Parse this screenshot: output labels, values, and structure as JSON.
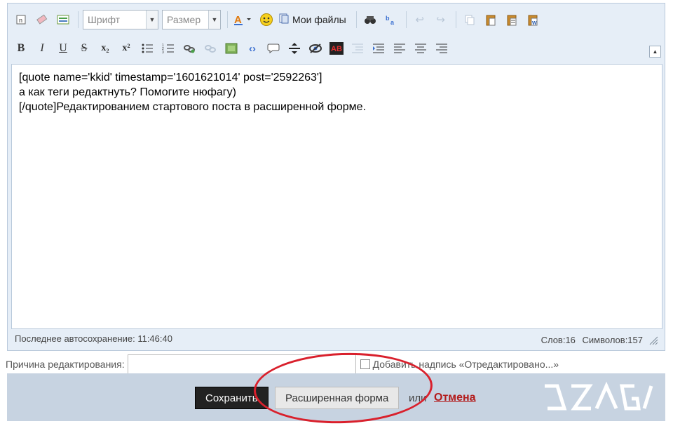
{
  "toolbar": {
    "font_placeholder": "Шрифт",
    "size_placeholder": "Размер",
    "my_files_label": "Мои файлы",
    "bold": "B",
    "italic": "I",
    "underline": "U",
    "strike": "S",
    "subscript": "x₂",
    "superscript": "x²",
    "collapse_glyph": "▲"
  },
  "editor": {
    "lines": [
      "[quote name='kkid' timestamp='1601621014' post='2592263']",
      "а как теги редактнуть? Помогите нюфагу)",
      "[/quote]Редактированием стартового поста в расширенной форме."
    ]
  },
  "status": {
    "autosave": "Последнее автосохранение: 11:46:40",
    "words": "Слов:16",
    "chars": "Символов:157"
  },
  "reason": {
    "label": "Причина редактирования:",
    "checkbox_label": "Добавить надпись «Отредактировано...»"
  },
  "footer": {
    "save_label": "Сохранить",
    "extended_label": "Расширенная форма",
    "or_text": "или",
    "cancel_label": "Отмена",
    "logo_text": "DZAGI"
  },
  "colors": {
    "editor_bg": "#e6eef7",
    "footer_bg": "#c7d3e1",
    "save_bg": "#222222",
    "cancel": "#b31b1b",
    "annotation_ring": "#d9202c"
  }
}
